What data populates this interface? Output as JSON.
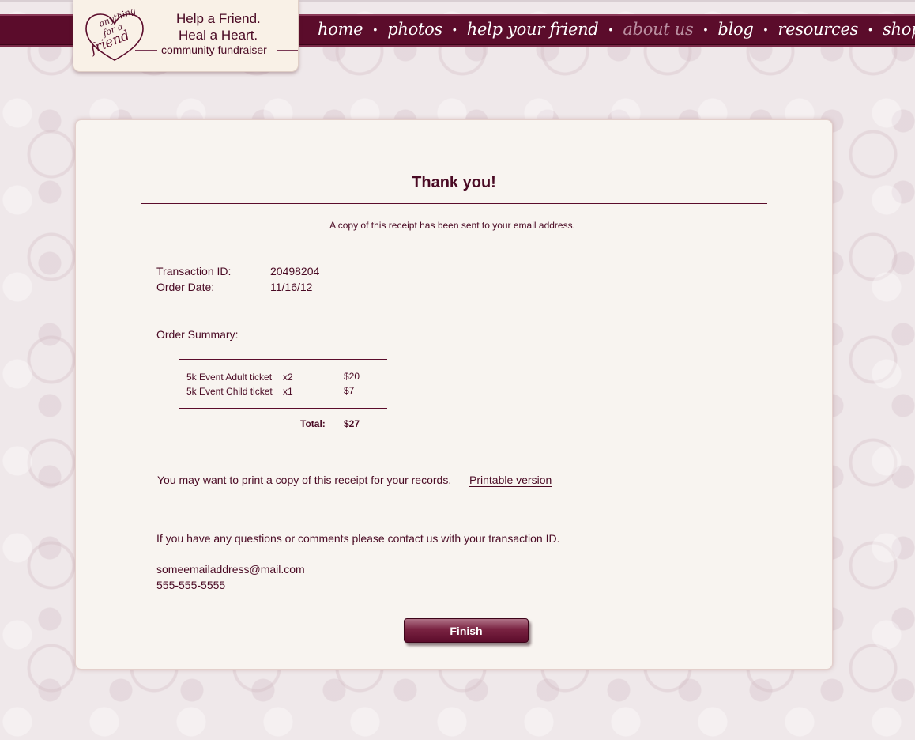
{
  "logo": {
    "line1": "Help a Friend.",
    "line2": "Heal a Heart.",
    "line3": "community fundraiser",
    "heart_word1": "anything",
    "heart_word2": "for a",
    "heart_word3": "friend"
  },
  "nav": {
    "items": [
      {
        "label": "home"
      },
      {
        "label": "photos"
      },
      {
        "label": "help your friend"
      },
      {
        "label": "about us",
        "current": true
      },
      {
        "label": "blog"
      },
      {
        "label": "resources"
      },
      {
        "label": "shop"
      }
    ],
    "separator": "•"
  },
  "receipt": {
    "title": "Thank you!",
    "email_note": "A copy of this receipt has been sent to your email address.",
    "transaction_label": "Transaction ID:",
    "transaction_id": "20498204",
    "order_date_label": "Order Date:",
    "order_date": "11/16/12",
    "summary_label": "Order Summary:",
    "items": [
      {
        "name": "5k Event Adult ticket",
        "qty": "x2",
        "price": "$20"
      },
      {
        "name": "5k Event Child ticket",
        "qty": "x1",
        "price": "$7"
      }
    ],
    "total_label": "Total:",
    "total": "$27",
    "print_note": "You may want to print a copy of this receipt for your records.",
    "print_link": "Printable version",
    "contact_note": "If you have any questions or comments please contact us with your transaction ID.",
    "contact_email": "someemailaddress@mail.com",
    "contact_phone": "555-555-5555",
    "finish_label": "Finish"
  },
  "colors": {
    "brand": "#5b0c2b",
    "text": "#4a0a24",
    "nav_current": "#b98ea0",
    "card_bg": "#f8f4f0",
    "page_bg": "#efe8ea"
  }
}
